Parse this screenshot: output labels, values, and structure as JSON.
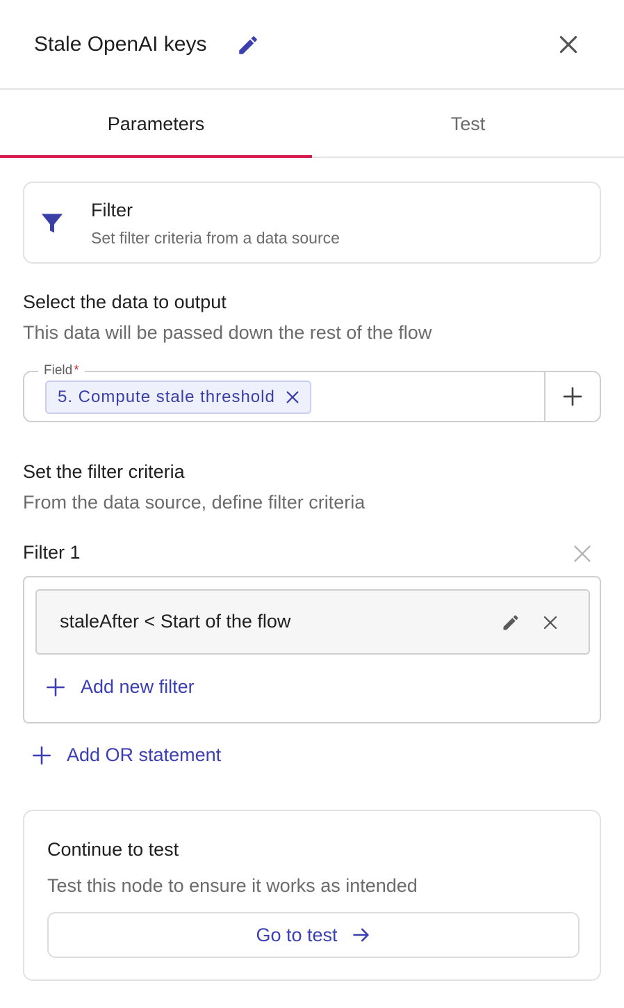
{
  "header": {
    "title": "Stale OpenAI keys"
  },
  "tabs": [
    {
      "label": "Parameters",
      "active": true
    },
    {
      "label": "Test",
      "active": false
    }
  ],
  "node": {
    "title": "Filter",
    "subtitle": "Set filter criteria from a data source",
    "icon": "filter-funnel-icon"
  },
  "output_section": {
    "title": "Select the data to output",
    "subtitle": "This data will be passed down the rest of the flow",
    "field_label": "Field",
    "required_marker": "*",
    "selected_chip": "5. Compute stale threshold"
  },
  "criteria_section": {
    "title": "Set the filter criteria",
    "subtitle": "From the data source, define filter criteria"
  },
  "filters": [
    {
      "label": "Filter 1",
      "conditions": [
        "staleAfter < Start of the flow"
      ],
      "add_label": "Add new filter"
    }
  ],
  "add_or_label": "Add OR statement",
  "test_card": {
    "title": "Continue to test",
    "subtitle": "Test this node to ensure it works as intended",
    "button_label": "Go to test"
  },
  "colors": {
    "accent": "#3b3fb2",
    "tab_underline": "#d81b4a",
    "chip_bg": "#eef0fb"
  }
}
